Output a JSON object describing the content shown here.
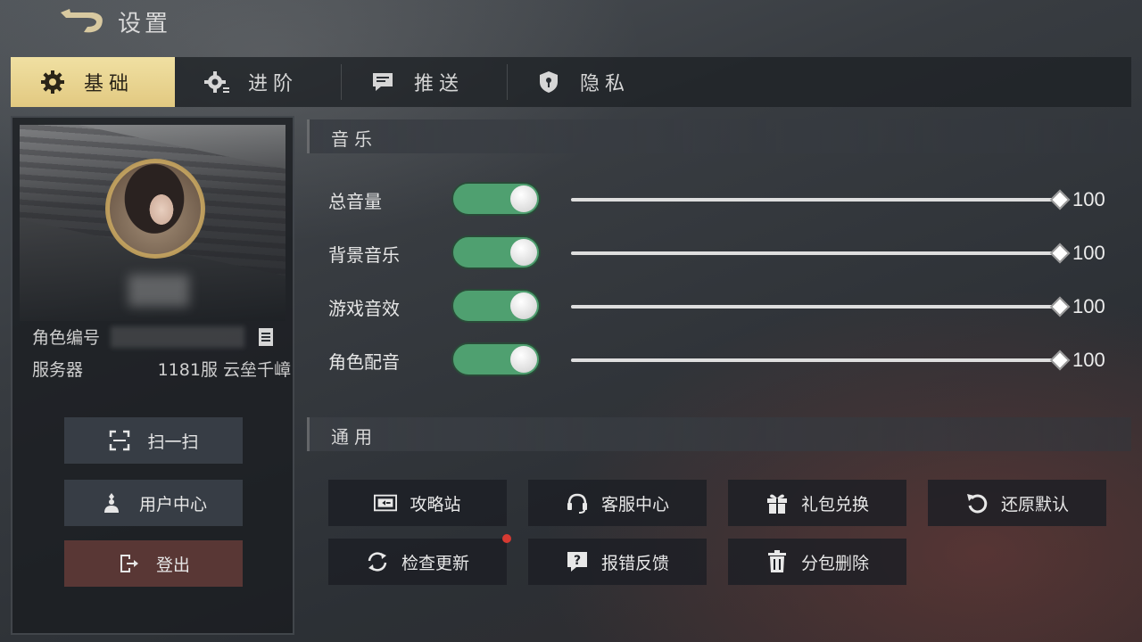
{
  "header": {
    "title": "设置"
  },
  "tabs": [
    {
      "label": "基础",
      "icon": "gear-icon",
      "active": true
    },
    {
      "label": "进阶",
      "icon": "advanced-gear-icon",
      "active": false
    },
    {
      "label": "推送",
      "icon": "message-icon",
      "active": false
    },
    {
      "label": "隐私",
      "icon": "shield-icon",
      "active": false
    }
  ],
  "profile": {
    "id_label": "角色编号",
    "server_label": "服务器",
    "server_value": "1181服 云垒千嶂",
    "buttons": {
      "scan": "扫一扫",
      "user_center": "用户中心",
      "logout": "登出"
    }
  },
  "music": {
    "header": "音乐",
    "rows": [
      {
        "label": "总音量",
        "enabled": true,
        "value": 100
      },
      {
        "label": "背景音乐",
        "enabled": true,
        "value": 100
      },
      {
        "label": "游戏音效",
        "enabled": true,
        "value": 100
      },
      {
        "label": "角色配音",
        "enabled": true,
        "value": 100
      }
    ]
  },
  "general": {
    "header": "通用",
    "buttons": {
      "guide": "攻略站",
      "service": "客服中心",
      "gift": "礼包兑换",
      "restore": "还原默认",
      "update": "检查更新",
      "feedback": "报错反馈",
      "delete_pack": "分包删除"
    },
    "update_has_notice": true
  },
  "colors": {
    "tab_active": "#e8d18e",
    "toggle_on": "#4fa070",
    "notice_dot": "#d63a32",
    "logout_button": "#5f3a37"
  }
}
